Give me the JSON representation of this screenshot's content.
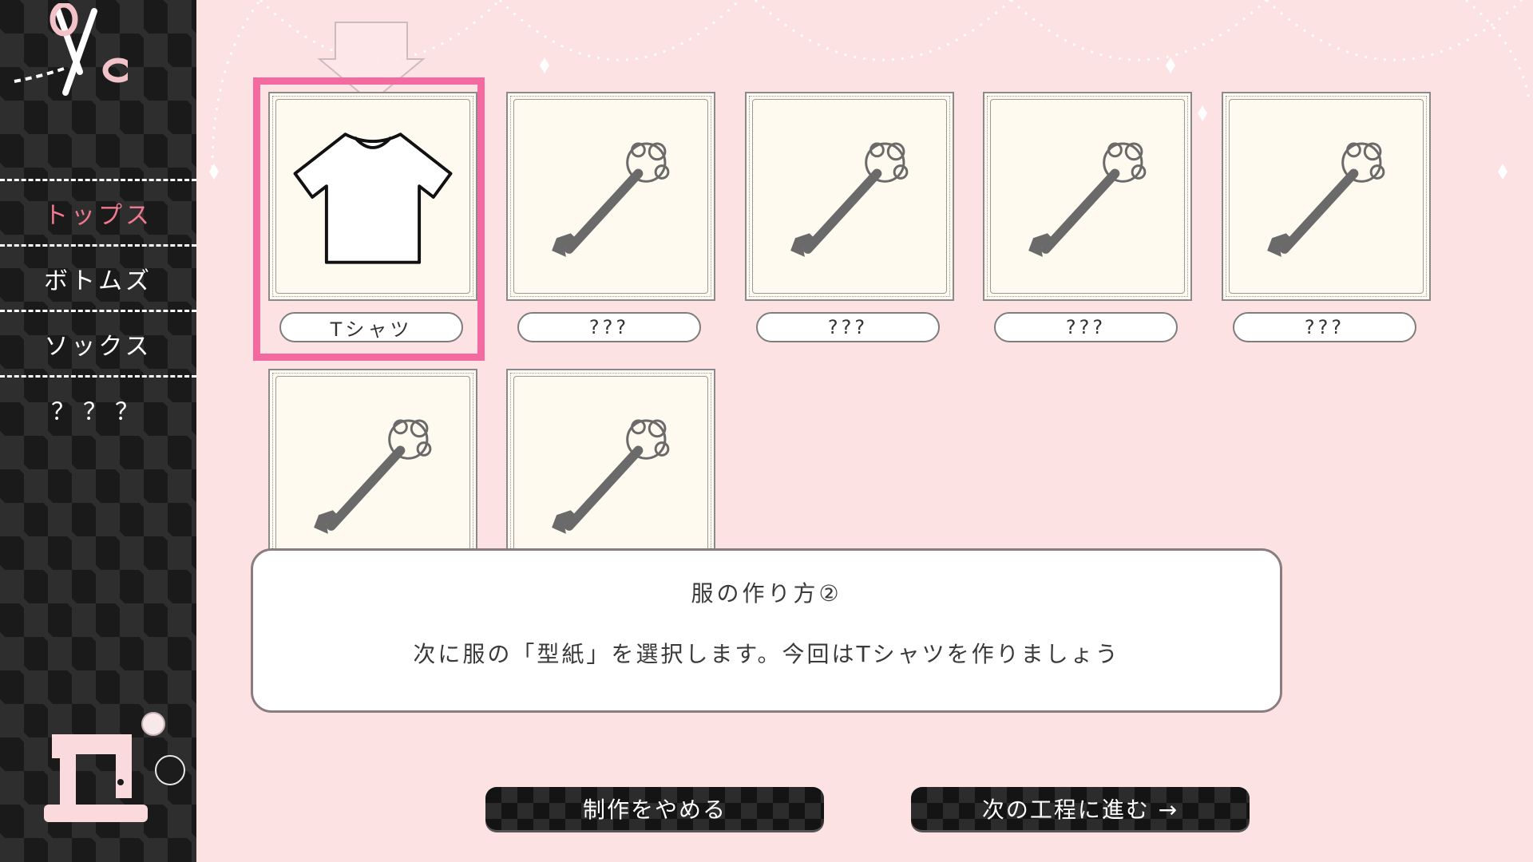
{
  "sidebar": {
    "items": [
      {
        "label": "トップス",
        "active": true
      },
      {
        "label": "ボトムズ",
        "active": false
      },
      {
        "label": "ソックス",
        "active": false
      },
      {
        "label": "？？？",
        "active": false
      }
    ],
    "icons": [
      "scissors-icon",
      "sewing-machine-icon",
      "button-icon"
    ]
  },
  "patterns": {
    "selected_index": 0,
    "items": [
      {
        "label": "Tシャツ",
        "icon": "tshirt-icon",
        "unlocked": true
      },
      {
        "label": "???",
        "icon": "key-icon",
        "unlocked": false
      },
      {
        "label": "???",
        "icon": "key-icon",
        "unlocked": false
      },
      {
        "label": "???",
        "icon": "key-icon",
        "unlocked": false
      },
      {
        "label": "???",
        "icon": "key-icon",
        "unlocked": false
      },
      {
        "label": "",
        "icon": "key-icon",
        "unlocked": false
      },
      {
        "label": "",
        "icon": "key-icon",
        "unlocked": false
      }
    ]
  },
  "tutorial": {
    "title": "服の作り方②",
    "message": "次に服の「型紙」を選択します。今回はTシャツを作りましょう"
  },
  "buttons": {
    "quit": "制作をやめる",
    "next": "次の工程に進む →"
  },
  "colors": {
    "background": "#fde2e4",
    "highlight": "#f36aa0",
    "active_tab": "#f07a8e",
    "sidebar": "#1a1a1a"
  }
}
